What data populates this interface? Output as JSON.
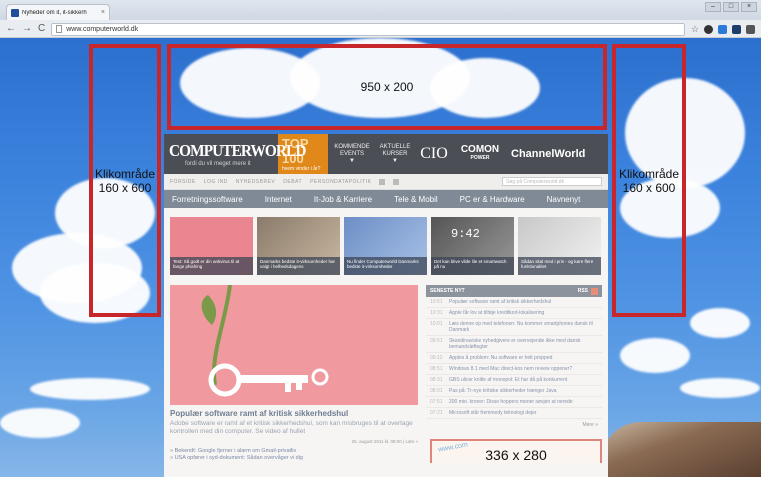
{
  "browser": {
    "tab_title": "Nyheder om it, it-sikkerh",
    "tab_close": "×",
    "url": "www.computerworld.dk",
    "back": "←",
    "forward": "→",
    "reload": "C",
    "star": "☆"
  },
  "zones": {
    "left": "Klikområde\n160 x 600",
    "top": "950 x 200",
    "right": "Klikområde\n160 x 600"
  },
  "site": {
    "logo": "COMPUTERWORLD",
    "tagline": "fordi du vil meget mere it",
    "top100": {
      "title": "TOP 100",
      "sub": "hvem vinder i år?"
    },
    "masthead_items": [
      "KOMMENDE EVENTS",
      "AKTUELLE KURSER"
    ],
    "cio": "CIO",
    "comon": "COMON",
    "comon_sub": "POWER",
    "channelworld": "ChannelWorld",
    "util_links": [
      "FORSIDE",
      "LOG IND",
      "NYHEDSBREV",
      "DEBAT",
      "PERSONDATAPOLITIK"
    ],
    "search_placeholder": "Søg på Computerworld.dk",
    "nav": [
      "Forretningssoftware",
      "Internet",
      "It-Job & Karriere",
      "Tele & Mobil",
      "PC er & Hardware",
      "Navnenyt"
    ],
    "teasers": [
      "Test: Så godt er din antivirus til at fange phishing",
      "Danmarks bedste it-virksomheder har valgt i helhedsdagens",
      "Nu finder Computerworld Danmarks bedste it-virksomheder",
      "Det kan blive vilde lile et smartwatch på nu",
      "Sådan skal med i pris - og køre flere funktionalitet"
    ],
    "teaser_clock": "9:42",
    "lead_title": "Populær software ramt af kritisk sikkerhedshul",
    "lead_text": "Adobe software er ramt af et kritisk sikkerhedshul, som kan misbruges til at overtage kontrollen med din computer. Se video af hullet",
    "lead_meta": "25. august 2011 kl. 08:00 | Læs »",
    "lead_links": [
      "» Bekendt: Google fjerner i alarm om Gmail-privatliv",
      "» USA opfører i syd-dokument: Sådan overvåger vi dig"
    ],
    "news_head": "SENESTE NYT",
    "news_head_right": "RSS",
    "news": [
      {
        "t": "10:51",
        "x": "Populær software ramt af kritisk sikkerhedshul"
      },
      {
        "t": "10:31",
        "x": "Apple får lov at tilføje kreditkort-lokalisering"
      },
      {
        "t": "10:01",
        "x": "Læs denne op med telefonen: Nu kommer smartphones dansk til Danmark"
      },
      {
        "t": "09:51",
        "x": "Skandinaviske nyhedgivere er overvejende ikke med dansk bemandsløftegter"
      },
      {
        "t": "09:12",
        "x": "Apples å problem: Nu software er helt propped"
      },
      {
        "t": "08:51",
        "x": "Windows 8.1 med Mac direct-kos nem review oppener?"
      },
      {
        "t": "08:31",
        "x": "GBS ulicer knitle af monopol: Et har då på konkurrent"
      },
      {
        "t": "08:01",
        "x": "Pas på: Tr-nye kritiske sikkerheder trænger Java"
      },
      {
        "t": "07:51",
        "x": "200 mio. kroner: Disse hoppers mener søvjen at nerede"
      },
      {
        "t": "07:21",
        "x": "Microsoft står fremmedy teknologi dejer"
      }
    ],
    "more": "Mere »",
    "ad_label": "336 x 280",
    "ad_watermark": "www.com"
  },
  "colors": {
    "zone_border": "#c7272a",
    "masthead": "#4b4f55",
    "top100": "#e0891a",
    "nav": "#7f8a96",
    "lead_image": "#f09aa0"
  }
}
